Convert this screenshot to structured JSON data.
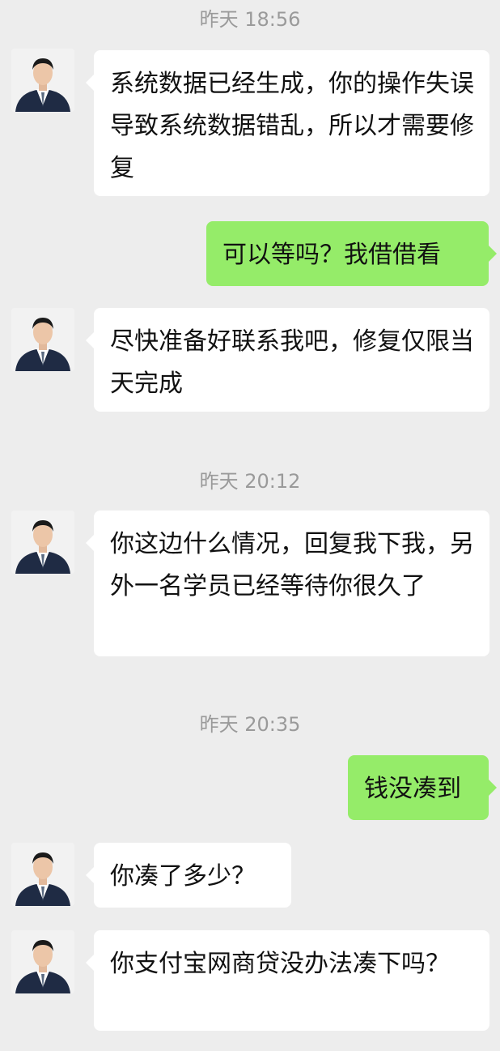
{
  "timestamps": [
    "昨天 18:56",
    "昨天 20:12",
    "昨天 20:35"
  ],
  "messages": [
    {
      "sender": "contact",
      "text": "系统数据已经生成，你的操作失误导致系统数据错乱，所以才需要修复"
    },
    {
      "sender": "me",
      "text": "可以等吗？我借借看"
    },
    {
      "sender": "contact",
      "text": "尽快准备好联系我吧，修复仅限当天完成"
    },
    {
      "sender": "contact",
      "text": "你这边什么情况，回复我下我，另外一名学员已经等待你很久了"
    },
    {
      "sender": "me",
      "text": "钱没凑到"
    },
    {
      "sender": "contact",
      "text": "你凑了多少？"
    },
    {
      "sender": "contact",
      "text": "你支付宝网商贷没办法凑下吗？"
    }
  ],
  "colors": {
    "background": "#ededed",
    "incoming_bubble": "#ffffff",
    "outgoing_bubble": "#95ec69",
    "timestamp_text": "#9a9a9a"
  },
  "icons": {
    "contact_avatar": "person-in-suit-avatar"
  }
}
